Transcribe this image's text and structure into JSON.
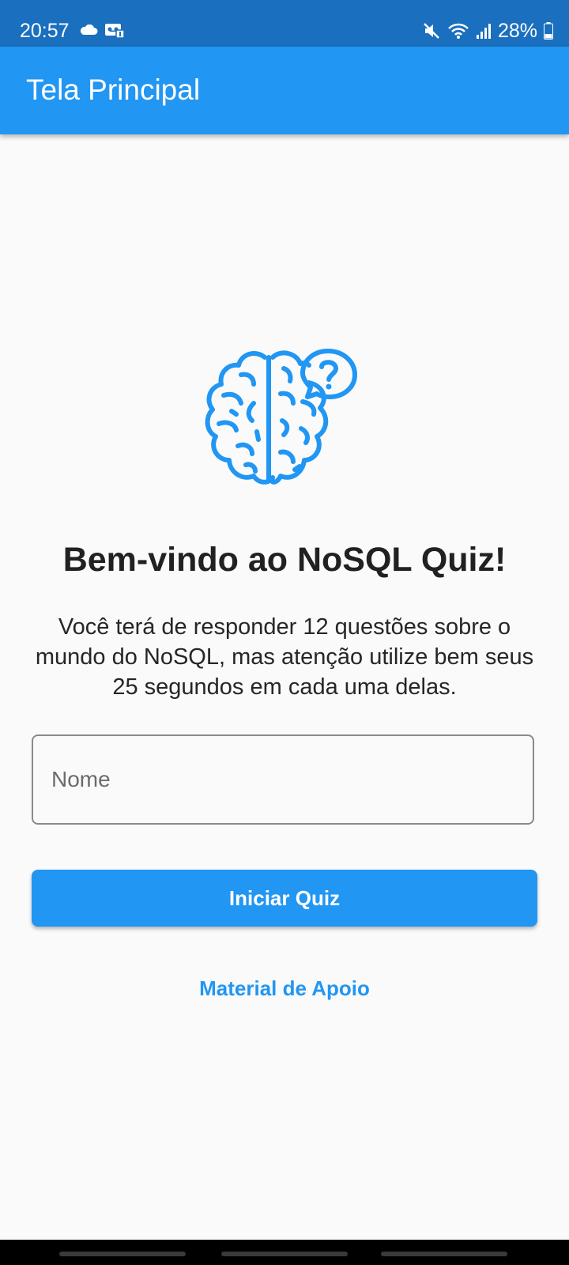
{
  "status_bar": {
    "time": "20:57",
    "battery": "28%",
    "icons": [
      "cloud-icon",
      "voicemail-icon",
      "mute-icon",
      "wifi-icon",
      "signal-icon",
      "battery-icon"
    ]
  },
  "app_bar": {
    "title": "Tela Principal"
  },
  "main": {
    "hero_icon": "brain-question-icon",
    "welcome": "Bem-vindo ao NoSQL Quiz!",
    "description": "Você terá de responder 12 questões sobre o mundo do NoSQL, mas atenção utilize bem seus 25 segundos em cada uma delas.",
    "name_field": {
      "placeholder": "Nome",
      "value": ""
    },
    "start_button": "Iniciar Quiz",
    "support_link": "Material de Apoio"
  },
  "colors": {
    "status_bar": "#1a6fbe",
    "primary": "#2196f3",
    "background": "#fafafa",
    "text": "#212121"
  }
}
